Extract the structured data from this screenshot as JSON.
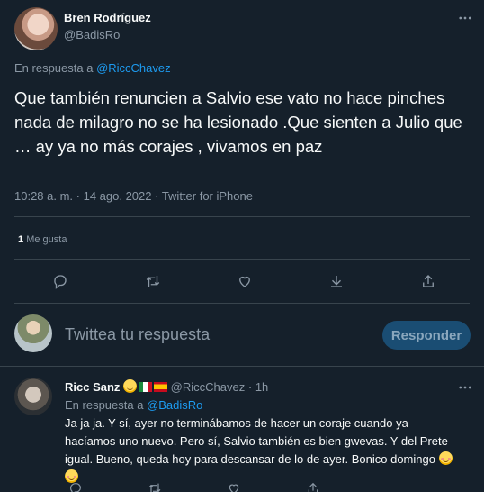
{
  "tweet": {
    "author_name": "Bren Rodríguez",
    "author_handle": "@BadisRo",
    "reply_prefix": "En respuesta a ",
    "reply_to": "@RiccChavez",
    "text": "Que también renuncien a Salvio ese vato no hace pinches nada de milagro no se ha lesionado .Que sienten a Julio que … ay ya no más corajes , vivamos en paz",
    "timestamp": "10:28 a. m. · 14 ago. 2022 · Twitter for iPhone",
    "likes_count": "1",
    "likes_label": "Me gusta"
  },
  "composer": {
    "placeholder": "Twittea tu respuesta",
    "button_label": "Responder"
  },
  "reply": {
    "author_name": "Ricc Sanz",
    "author_handle": "@RiccChavez",
    "separator": "·",
    "time": "1h",
    "reply_prefix": "En respuesta a ",
    "reply_to": "@BadisRo",
    "text": "Ja ja ja. Y sí, ayer no terminábamos de hacer un coraje cuando ya hacíamos uno nuevo. Pero sí, Salvio también es bien gwevas. Y del Prete igual. Bueno, queda hoy para descansar de lo de ayer. Bonico domingo"
  },
  "colors": {
    "background": "#15202b",
    "text": "#f7f9f9",
    "muted": "#8b98a5",
    "link": "#1d9bf0",
    "divider": "#38444d",
    "reply_button_bg": "#1a4d73"
  },
  "icons": [
    "more-icon",
    "reply-icon",
    "retweet-icon",
    "like-icon",
    "bookmark-icon",
    "share-icon"
  ]
}
